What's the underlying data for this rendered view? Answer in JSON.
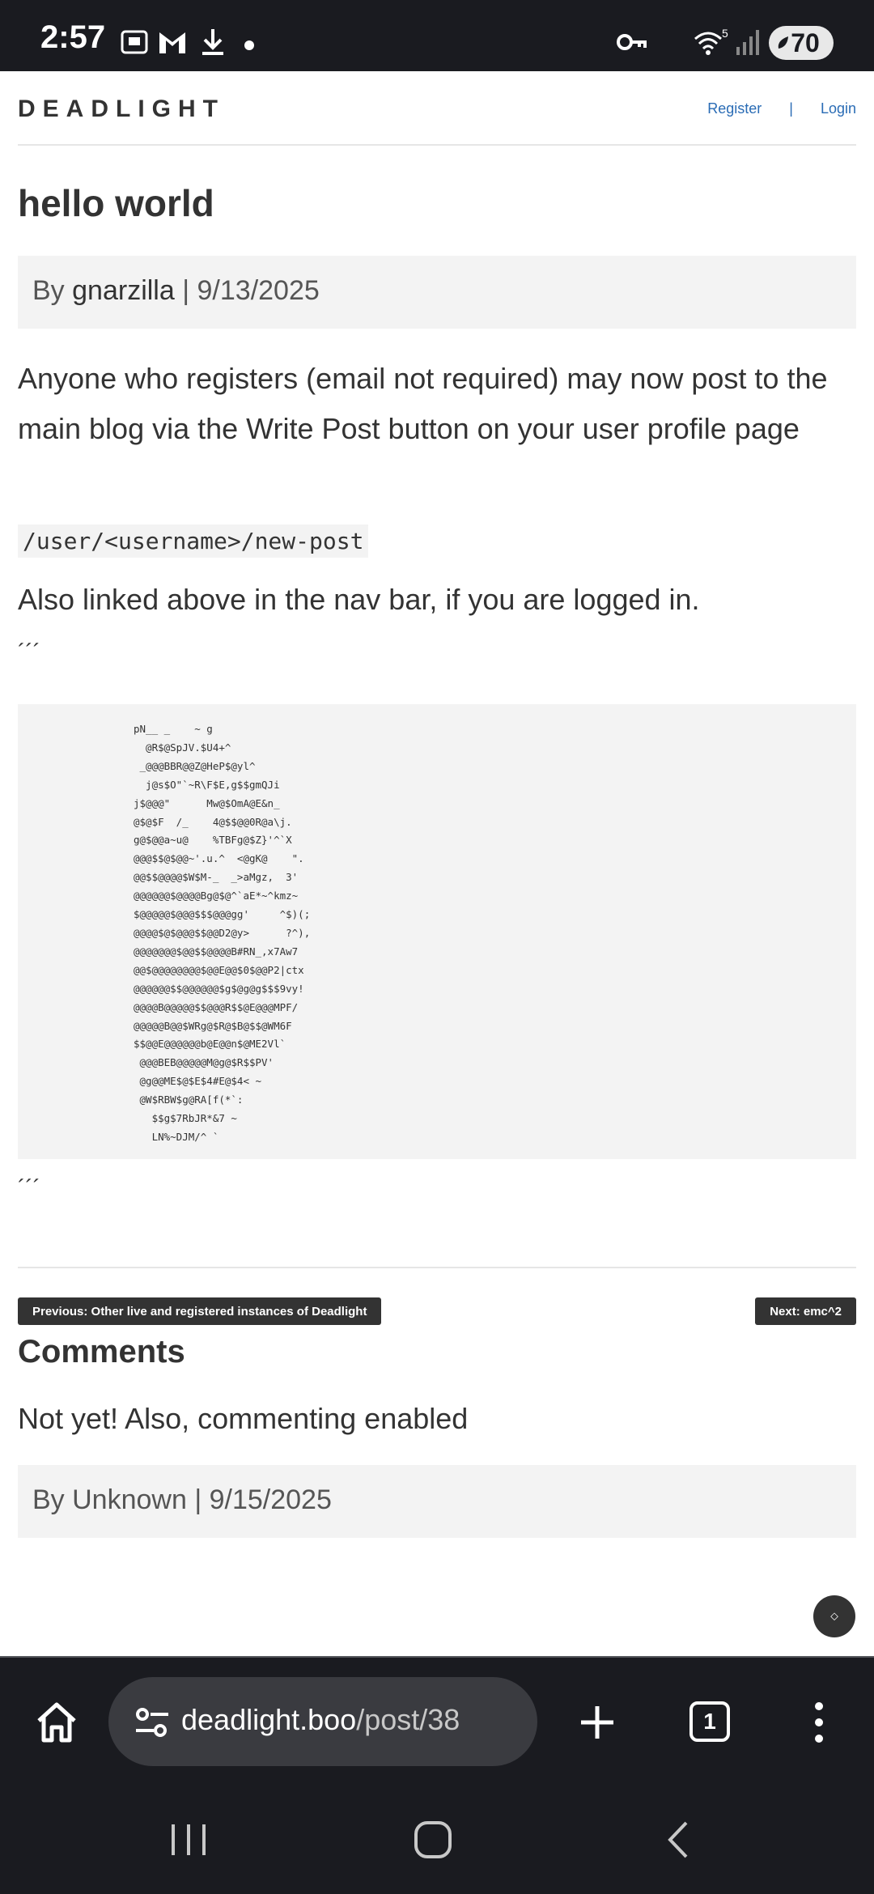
{
  "status_bar": {
    "time": "2:57",
    "battery": "70",
    "wifi_label": "5",
    "icons": [
      "screenshot-icon",
      "gmail-icon",
      "download-icon",
      "dot-icon",
      "key-icon",
      "wifi-icon",
      "signal-icon",
      "battery-saver-icon"
    ]
  },
  "header": {
    "brand": "DEADLIGHT",
    "register": "Register",
    "separator": "|",
    "login": "Login"
  },
  "post": {
    "title": "hello world",
    "meta_prefix": "By",
    "author": "gnarzilla",
    "meta_sep": "|",
    "date": "9/13/2025",
    "paragraph1": "Anyone who registers (email not required) may now post to the main blog via the Write Post button on your user profile page",
    "inline_code": "/user/<username>/new-post",
    "paragraph2": "Also linked above in the nav bar, if you are logged in.",
    "ticks_open": "´´´",
    "ticks_close": "´´´",
    "ascii_art": "                   pN__ _    ~ g\n                     @R$@SpJV.$U4+^\n                    _@@@BBR@@Z@HeP$@yl^\n                     j@s$O\"`~R\\F$E,g$$gmQJi\n                   j$@@@\"      Mw@$OmA@E&n_\n                   @$@$F  /_    4@$$@@0R@a\\j.\n                   g@$@@a~u@    %TBFg@$Z}'^`X\n                   @@@$$@$@@~'.u.^  <@gK@    \".\n                   @@$$@@@@$W$M-_  _>aMgz,  3'\n                   @@@@@@$@@@@Bg@$@^`aE*~^kmz~\n                   $@@@@@$@@@$$$@@@gg'     ^$)(;\n                   @@@@$@$@@@$$@@D2@y>      ?^),\n                   @@@@@@@$@@$$@@@@B#RN_,x7Aw7\n                   @@$@@@@@@@@$@@E@@$0$@@P2|ctx\n                   @@@@@@$$@@@@@@$g$@g@g$$$9vy!\n                   @@@@B@@@@@$$@@@R$$@E@@@MPF/\n                   @@@@@B@@$WRg@$R@$B@$$@WM6F\n                   $$@@E@@@@@@b@E@@n$@ME2Vl`\n                    @@@BEB@@@@@M@g@$R$$PV'\n                    @g@@ME$@$E$4#E@$4< ~\n                    @W$RBW$g@RA[f(*`:\n                      $$g$7RbJR*&7 ~\n                      LN%~DJM/^ `"
  },
  "pagination": {
    "prev": "Previous: Other live and registered instances of Deadlight",
    "next": "Next: emc^2"
  },
  "comments": {
    "heading": "Comments",
    "items": [
      {
        "body": "Not yet! Also, commenting enabled",
        "meta": "By Unknown | 9/15/2025"
      }
    ]
  },
  "fab": {
    "icon": "diamond-icon",
    "symbol": "⬦"
  },
  "browser": {
    "url_host": "deadlight.boo",
    "url_path": "/post/38",
    "tab_count": "1"
  }
}
